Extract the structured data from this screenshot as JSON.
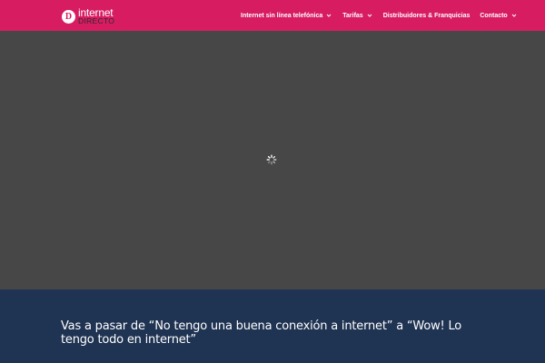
{
  "header": {
    "logo": {
      "mark": "D",
      "word1": "internet",
      "word2": "DIRECTO"
    },
    "nav": [
      {
        "label": "Internet sin línea telefónica",
        "has_dropdown": true
      },
      {
        "label": "Tarifas",
        "has_dropdown": true
      },
      {
        "label": "Distribuidores & Franquicias",
        "has_dropdown": false
      },
      {
        "label": "Contacto",
        "has_dropdown": true
      }
    ]
  },
  "section": {
    "headline": "Vas a pasar de “No tengo una buena conexión a internet”  a “Wow! Lo tengo todo en internet”"
  },
  "colors": {
    "header_bg": "#d81c62",
    "hero_bg": "#474747",
    "section_bg": "#1f3352",
    "text": "#ffffff"
  },
  "icons": {
    "loading": "loading-spinner-icon",
    "dropdown": "chevron-down-icon"
  }
}
